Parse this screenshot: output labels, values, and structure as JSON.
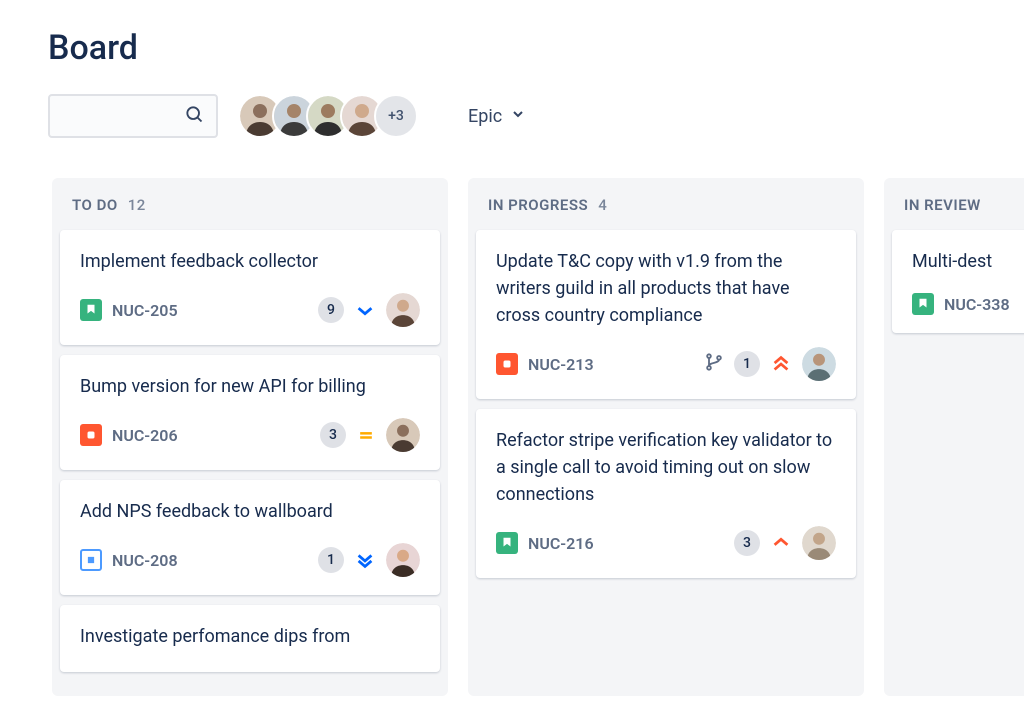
{
  "header": {
    "title": "Board"
  },
  "toolbar": {
    "search_placeholder": "",
    "avatar_overflow": "+3",
    "epic_label": "Epic"
  },
  "columns": [
    {
      "name": "TO DO",
      "count": "12",
      "cards": [
        {
          "title": "Implement feedback collector",
          "key": "NUC-205",
          "issue_type": "story",
          "badge": "9",
          "priority": "low",
          "has_branch": false
        },
        {
          "title": "Bump version for new API for billing",
          "key": "NUC-206",
          "issue_type": "task",
          "badge": "3",
          "priority": "medium",
          "has_branch": false
        },
        {
          "title": "Add NPS feedback to wallboard",
          "key": "NUC-208",
          "issue_type": "sub",
          "badge": "1",
          "priority": "lowest",
          "has_branch": false
        },
        {
          "title": "Investigate perfomance dips from",
          "key": "",
          "issue_type": "",
          "badge": "",
          "priority": "",
          "has_branch": false
        }
      ]
    },
    {
      "name": "IN PROGRESS",
      "count": "4",
      "cards": [
        {
          "title": "Update T&C copy with v1.9 from the writers guild in all products that have cross country compliance",
          "key": "NUC-213",
          "issue_type": "task",
          "badge": "1",
          "priority": "highest",
          "has_branch": true
        },
        {
          "title": "Refactor stripe verification key validator to a single call to avoid timing out on slow connections",
          "key": "NUC-216",
          "issue_type": "story",
          "badge": "3",
          "priority": "high",
          "has_branch": false
        }
      ]
    },
    {
      "name": "IN REVIEW",
      "count": "",
      "cards": [
        {
          "title": "Multi-dest",
          "key": "NUC-338",
          "issue_type": "story",
          "badge": "",
          "priority": "",
          "has_branch": false
        }
      ]
    }
  ]
}
